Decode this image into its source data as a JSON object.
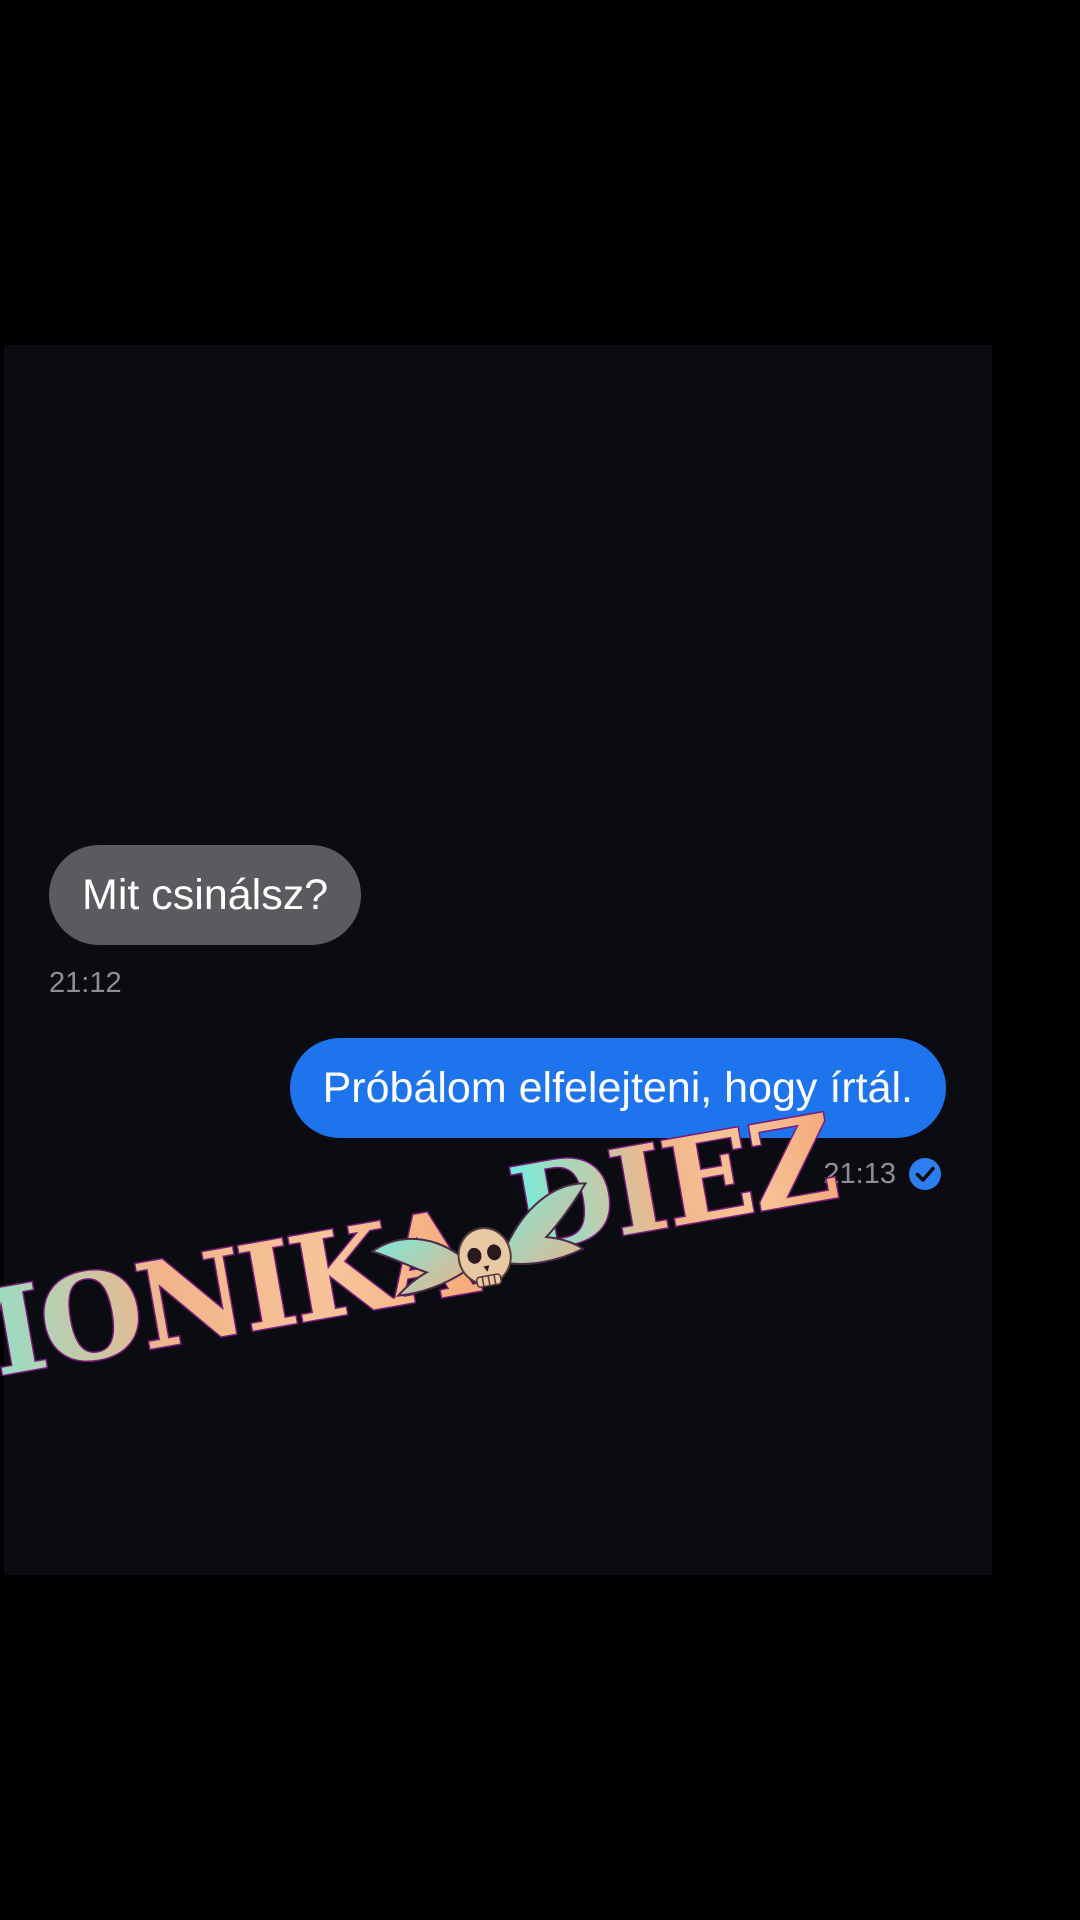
{
  "messages": [
    {
      "direction": "received",
      "text": "Mit csinálsz?",
      "time": "21:12"
    },
    {
      "direction": "sent",
      "text": "Próbálom elfelejteni, hogy írtál.",
      "time": "21:13",
      "status_icon": "check-circle-icon"
    }
  ],
  "watermark": {
    "left_word": "MONIKA",
    "right_word": "DIEZ",
    "emblem": "winged-skull-icon"
  },
  "colors": {
    "background": "#000000",
    "chat_background": "#0b0c12",
    "received_bubble": "#5b5b5f",
    "sent_bubble": "#1d74ec",
    "timestamp": "#8e8e94",
    "read_check": "#2d7ff0"
  }
}
